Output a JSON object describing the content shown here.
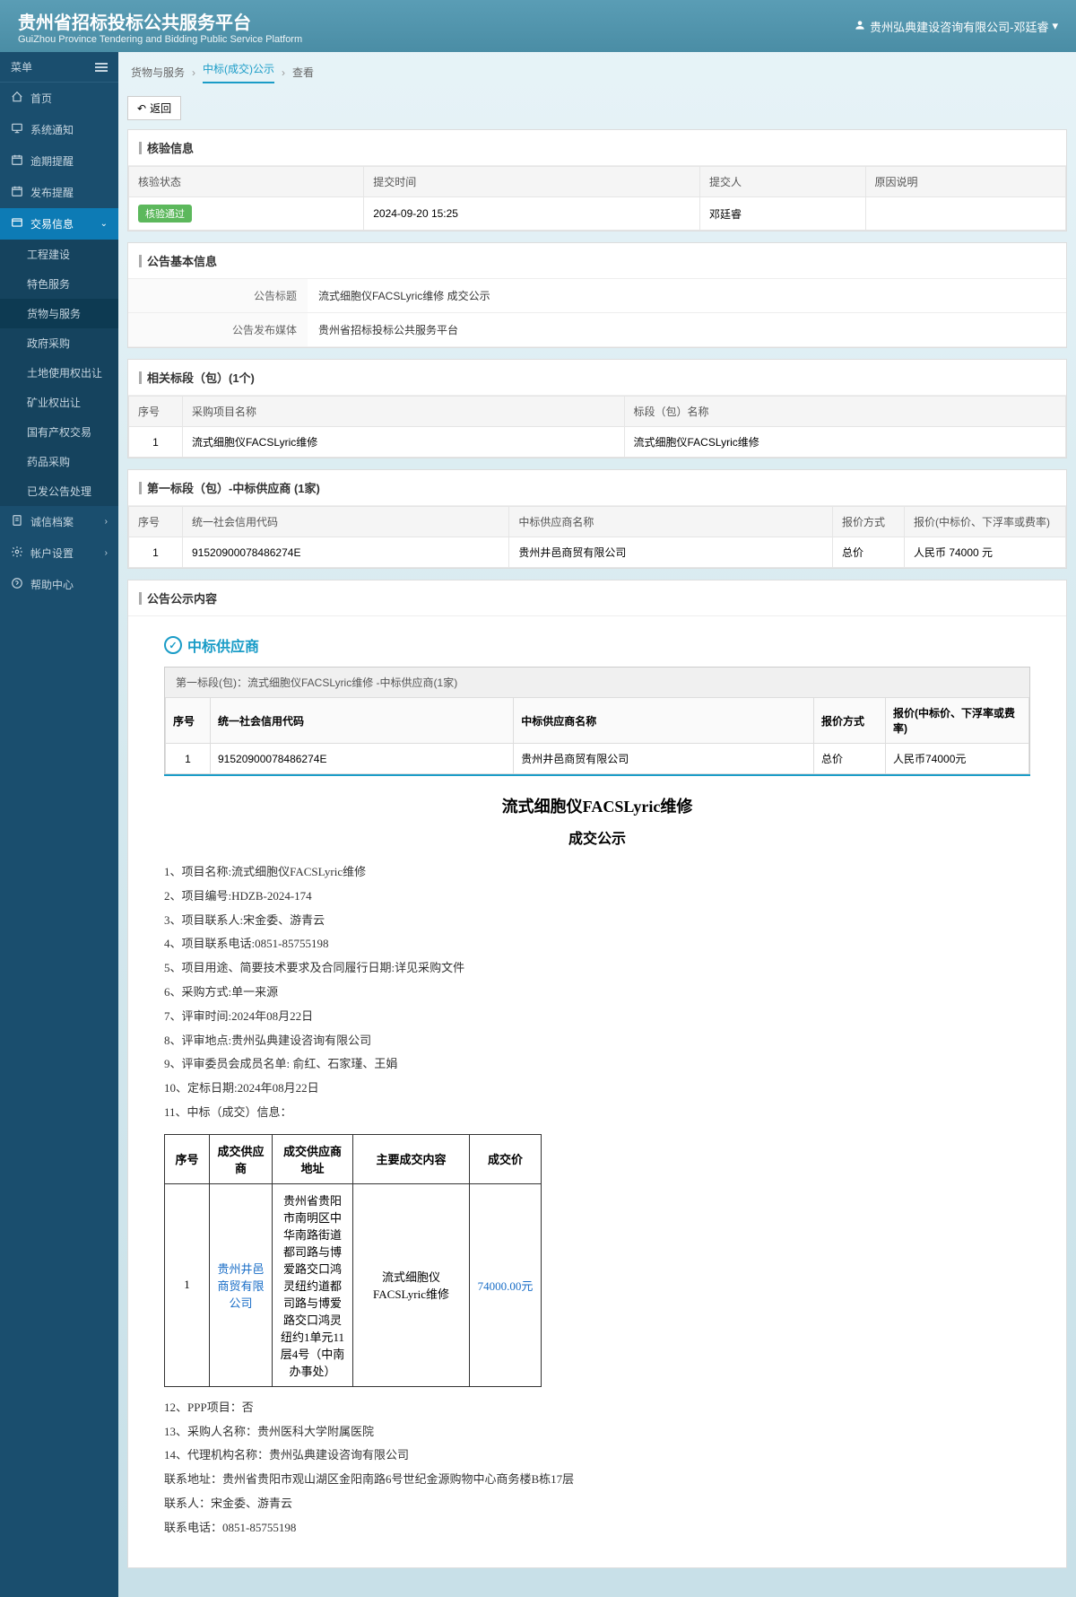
{
  "header": {
    "title": "贵州省招标投标公共服务平台",
    "subtitle": "GuiZhou Province Tendering and Bidding Public Service Platform",
    "user": "贵州弘典建设咨询有限公司-邓廷睿"
  },
  "sidebar": {
    "menu_label": "菜单",
    "items": [
      {
        "label": "首页",
        "icon": "home"
      },
      {
        "label": "系统通知",
        "icon": "monitor"
      },
      {
        "label": "逾期提醒",
        "icon": "calendar"
      },
      {
        "label": "发布提醒",
        "icon": "calendar"
      },
      {
        "label": "交易信息",
        "icon": "folder",
        "active": true,
        "expanded": true
      },
      {
        "label": "诚信档案",
        "icon": "file",
        "badge": true
      },
      {
        "label": "帐户设置",
        "icon": "gear",
        "badge": true
      },
      {
        "label": "帮助中心",
        "icon": "help"
      }
    ],
    "sub_items": [
      {
        "label": "工程建设"
      },
      {
        "label": "特色服务"
      },
      {
        "label": "货物与服务",
        "active": true
      },
      {
        "label": "政府采购"
      },
      {
        "label": "土地使用权出让"
      },
      {
        "label": "矿业权出让"
      },
      {
        "label": "国有产权交易"
      },
      {
        "label": "药品采购"
      },
      {
        "label": "已发公告处理"
      }
    ]
  },
  "breadcrumb": {
    "items": [
      "货物与服务",
      "中标(成交)公示",
      "查看"
    ]
  },
  "back_btn": "返回",
  "verify": {
    "title": "核验信息",
    "headers": [
      "核验状态",
      "提交时间",
      "提交人",
      "原因说明"
    ],
    "status": "核验通过",
    "time": "2024-09-20 15:25",
    "person": "邓廷睿",
    "reason": ""
  },
  "basic": {
    "title": "公告基本信息",
    "rows": [
      {
        "label": "公告标题",
        "value": "流式细胞仪FACSLyric维修 成交公示"
      },
      {
        "label": "公告发布媒体",
        "value": "贵州省招标投标公共服务平台"
      }
    ]
  },
  "sections": {
    "title": "相关标段（包）(1个)",
    "headers": [
      "序号",
      "采购项目名称",
      "标段（包）名称"
    ],
    "rows": [
      {
        "idx": "1",
        "proj": "流式细胞仪FACSLyric维修",
        "sect": "流式细胞仪FACSLyric维修"
      }
    ]
  },
  "winner": {
    "title": "第一标段（包）-中标供应商 (1家)",
    "headers": [
      "序号",
      "统一社会信用代码",
      "中标供应商名称",
      "报价方式",
      "报价(中标价、下浮率或费率)"
    ],
    "rows": [
      {
        "idx": "1",
        "code": "91520900078486274E",
        "name": "贵州井邑商贸有限公司",
        "method": "总价",
        "price": "人民币 74000 元"
      }
    ]
  },
  "content": {
    "title": "公告公示内容",
    "supplier_title": "中标供应商",
    "box_title": "第一标段(包)：流式细胞仪FACSLyric维修 -中标供应商(1家)",
    "box_headers": [
      "序号",
      "统一社会信用代码",
      "中标供应商名称",
      "报价方式",
      "报价(中标价、下浮率或费率)"
    ],
    "box_row": {
      "idx": "1",
      "code": "91520900078486274E",
      "name": "贵州井邑商贸有限公司",
      "method": "总价",
      "price": "人民币74000元"
    },
    "ann_title": "流式细胞仪FACSLyric维修",
    "ann_subtitle": "成交公示",
    "items": [
      "1、项目名称:流式细胞仪FACSLyric维修",
      "2、项目编号:HDZB-2024-174",
      "3、项目联系人:宋金委、游青云",
      "4、项目联系电话:0851-85755198",
      "5、项目用途、简要技术要求及合同履行日期:详见采购文件",
      "6、采购方式:单一来源",
      "7、评审时间:2024年08月22日",
      "8、评审地点:贵州弘典建设咨询有限公司",
      "9、评审委员会成员名单: 俞红、石家瑾、王娟",
      "10、定标日期:2024年08月22日",
      "11、中标（成交）信息："
    ],
    "deal_table": {
      "headers": [
        "序号",
        "成交供应商",
        "成交供应商地址",
        "主要成交内容",
        "成交价"
      ],
      "row": {
        "idx": "1",
        "supplier": "贵州井邑商贸有限公司",
        "address": "贵州省贵阳市南明区中华南路街道都司路与博爱路交口鸿灵纽约道都司路与博爱路交口鸿灵纽约1单元11层4号（中南办事处）",
        "content": "流式细胞仪FACSLyric维修",
        "price": "74000.00元"
      }
    },
    "items2": [
      "12、PPP项目：否",
      "13、采购人名称：贵州医科大学附属医院",
      "14、代理机构名称：贵州弘典建设咨询有限公司",
      "联系地址：贵州省贵阳市观山湖区金阳南路6号世纪金源购物中心商务楼B栋17层",
      "联系人：宋金委、游青云",
      "联系电话：0851-85755198"
    ]
  }
}
